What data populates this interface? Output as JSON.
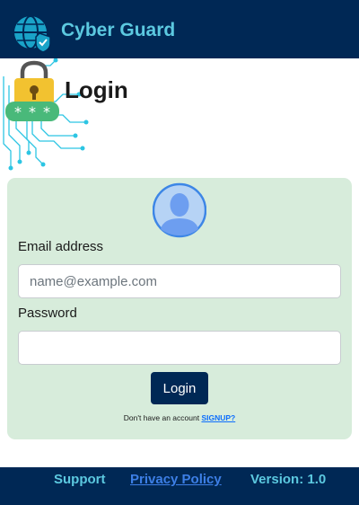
{
  "navbar": {
    "brand": "Cyber Guard",
    "logo_icon": "globe-shield-icon"
  },
  "hero": {
    "title": "Login",
    "illustration_icon": "padlock-password-icon"
  },
  "form": {
    "avatar_icon": "user-avatar-icon",
    "email_label": "Email address",
    "email_placeholder": "name@example.com",
    "email_value": "",
    "password_label": "Password",
    "password_value": "",
    "submit_label": "Login",
    "signup_prompt": "Don't have an account",
    "signup_link": "SIGNUP?"
  },
  "footer": {
    "support": "Support",
    "privacy": "Privacy Policy",
    "version": "Version: 1.0"
  },
  "colors": {
    "navbar_bg": "#002855",
    "brand_text": "#5cc9e0",
    "card_bg": "#d7ecdb",
    "button_bg": "#002855",
    "link": "#0d6efd"
  }
}
